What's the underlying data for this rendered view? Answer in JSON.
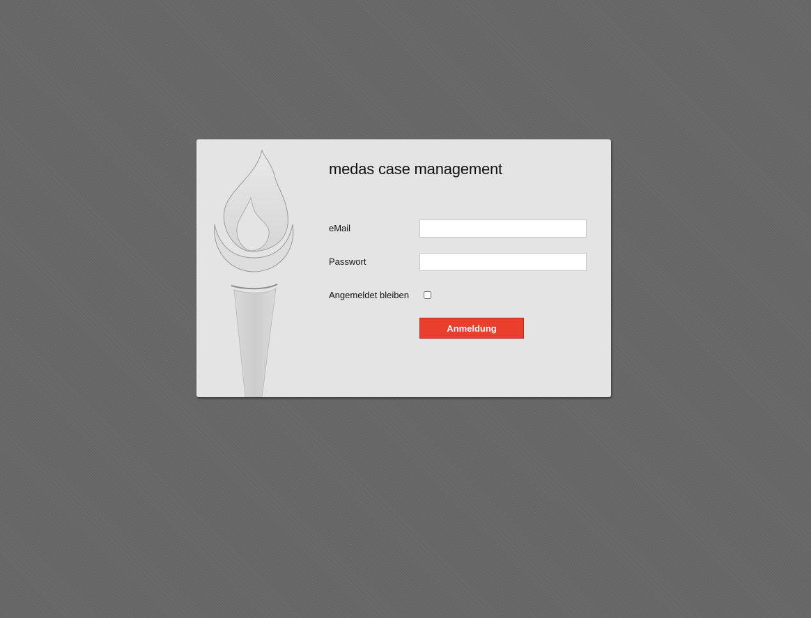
{
  "app": {
    "title": "medas case management",
    "logo_icon": "torch-icon"
  },
  "form": {
    "email_label": "eMail",
    "email_value": "",
    "password_label": "Passwort",
    "password_value": "",
    "remember_label": "Angemeldet bleiben",
    "remember_checked": false,
    "submit_label": "Anmeldung"
  },
  "colors": {
    "background": "#6a6a6a",
    "card": "#e4e4e4",
    "accent": "#ea3f2d"
  }
}
